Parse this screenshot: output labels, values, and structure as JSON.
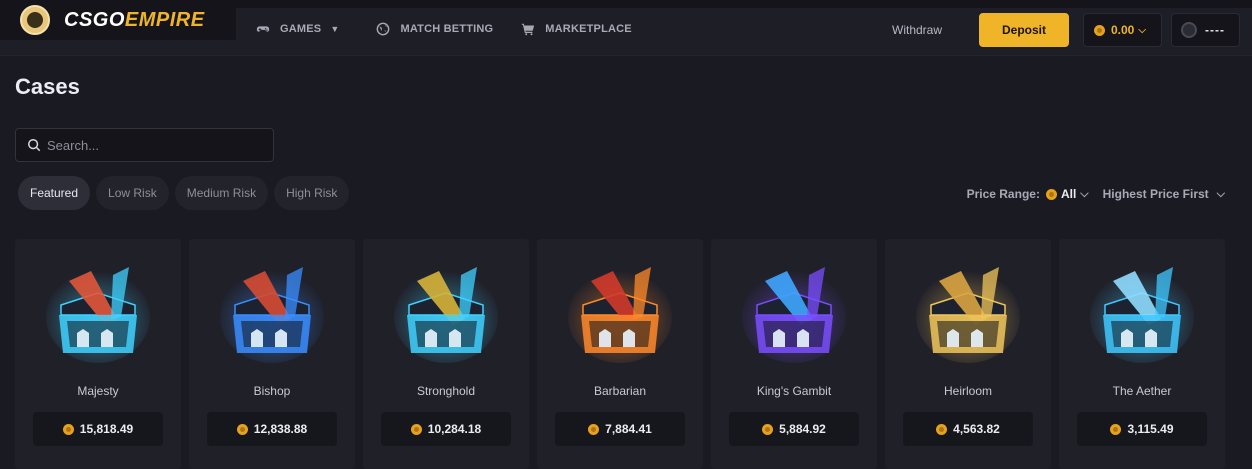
{
  "brand": {
    "part1": "CSGO",
    "part2": "EMPIRE"
  },
  "nav": {
    "games": "GAMES",
    "match_betting": "MATCH BETTING",
    "marketplace": "MARKETPLACE"
  },
  "header": {
    "withdraw": "Withdraw",
    "deposit": "Deposit",
    "balance": "0.00",
    "username": "----"
  },
  "page": {
    "title": "Cases"
  },
  "search": {
    "placeholder": "Search..."
  },
  "chips": [
    "Featured",
    "Low Risk",
    "Medium Risk",
    "High Risk"
  ],
  "active_chip": "Featured",
  "filters": {
    "price_range_label": "Price Range:",
    "price_range_value": "All",
    "sort": "Highest Price First"
  },
  "cases": [
    {
      "name": "Majesty",
      "price": "15,818.49",
      "accent": "#3fd1ff",
      "weapon": "#e0563a"
    },
    {
      "name": "Bishop",
      "price": "12,838.88",
      "accent": "#3a8dff",
      "weapon": "#d64b33"
    },
    {
      "name": "Stronghold",
      "price": "10,284.18",
      "accent": "#3fd1ff",
      "weapon": "#d6b338"
    },
    {
      "name": "Barbarian",
      "price": "7,884.41",
      "accent": "#ff8a2a",
      "weapon": "#d13a2a"
    },
    {
      "name": "King's Gambit",
      "price": "5,884.92",
      "accent": "#7a4dff",
      "weapon": "#3fa6ff"
    },
    {
      "name": "Heirloom",
      "price": "4,563.82",
      "accent": "#f0c65a",
      "weapon": "#d9a441"
    },
    {
      "name": "The Aether",
      "price": "3,115.49",
      "accent": "#3fc8ff",
      "weapon": "#8fdcff"
    }
  ]
}
